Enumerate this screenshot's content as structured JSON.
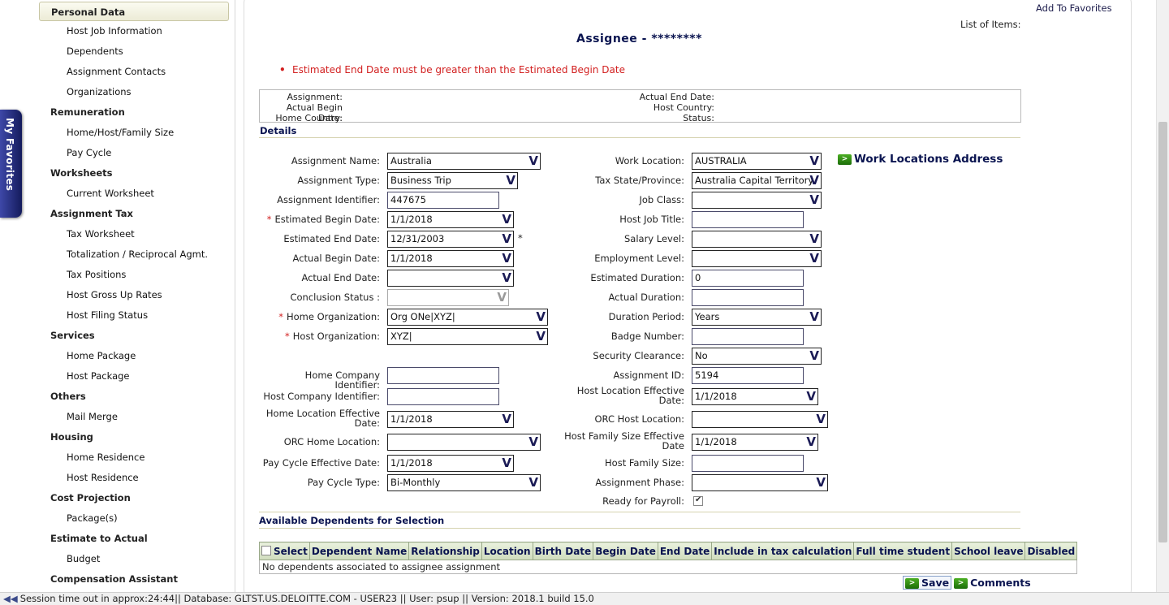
{
  "nav": {
    "sections": [
      {
        "label": "Personal Data",
        "active": true,
        "items": [
          "Host Job Information",
          "Dependents",
          "Assignment Contacts",
          "Organizations"
        ]
      },
      {
        "label": "Remuneration",
        "items": [
          "Home/Host/Family Size",
          "Pay Cycle"
        ]
      },
      {
        "label": "Worksheets",
        "items": [
          "Current Worksheet"
        ]
      },
      {
        "label": "Assignment Tax",
        "items": [
          "Tax Worksheet",
          "Totalization / Reciprocal Agmt.",
          "Tax Positions",
          "Host Gross Up Rates",
          "Host Filing Status"
        ]
      },
      {
        "label": "Services",
        "items": [
          "Home Package",
          "Host Package"
        ]
      },
      {
        "label": "Others",
        "items": [
          "Mail Merge"
        ]
      },
      {
        "label": "Housing",
        "items": [
          "Home Residence",
          "Host Residence"
        ]
      },
      {
        "label": "Cost Projection",
        "items": [
          "Package(s)"
        ]
      },
      {
        "label": "Estimate to Actual",
        "items": [
          "Budget"
        ]
      },
      {
        "label": "Compensation Assistant",
        "items": []
      }
    ],
    "my_favorites": "My Favorites"
  },
  "header": {
    "add_to_favorites": "Add To Favorites",
    "list_of_items": "List of Items:",
    "title": "Assignee - ********"
  },
  "error": {
    "bullet": "•",
    "message": "Estimated End Date must be greater than the Estimated Begin Date"
  },
  "summary": {
    "assignment": "Assignment:",
    "actual_begin_date": "Actual Begin Date:",
    "home_country": "Home Country:",
    "actual_end_date": "Actual End Date:",
    "host_country": "Host Country:",
    "status": "Status:"
  },
  "details_heading": "Details",
  "left_fields": [
    {
      "label": "Assignment Name:",
      "value": "Australia",
      "type": "select"
    },
    {
      "label": "Assignment Type:",
      "value": "Business Trip",
      "type": "select"
    },
    {
      "label": "Assignment Identifier:",
      "value": "447675",
      "type": "text"
    },
    {
      "label": "Estimated Begin Date:",
      "value": "1/1/2018",
      "type": "select",
      "required": true
    },
    {
      "label": "Estimated End Date:",
      "value": "12/31/2003",
      "type": "select"
    },
    {
      "label": "Actual Begin Date:",
      "value": "1/1/2018",
      "type": "select"
    },
    {
      "label": "Actual End Date:",
      "value": "",
      "type": "select"
    },
    {
      "label": "Conclusion Status :",
      "value": "",
      "type": "select",
      "disabled": true
    },
    {
      "label": "Home Organization:",
      "value": "Org ONe|XYZ|",
      "type": "select",
      "required": true
    },
    {
      "label": "Host Organization:",
      "value": "XYZ|",
      "type": "select",
      "required": true
    },
    {
      "label": "Home Company Identifier:",
      "value": "",
      "type": "text"
    },
    {
      "label": "Host Company Identifier:",
      "value": "",
      "type": "text"
    },
    {
      "label": "Home Location Effective Date:",
      "value": "1/1/2018",
      "type": "select"
    },
    {
      "label": "ORC Home Location:",
      "value": "",
      "type": "select"
    },
    {
      "label": "Pay Cycle Effective Date:",
      "value": "1/1/2018",
      "type": "select"
    },
    {
      "label": "Pay Cycle Type:",
      "value": "Bi-Monthly",
      "type": "select"
    }
  ],
  "required_mark": "*",
  "right_fields": [
    {
      "label": "Work Location:",
      "value": "AUSTRALIA",
      "type": "select"
    },
    {
      "label": "Tax State/Province:",
      "value": "Australia Capital Territory",
      "type": "select"
    },
    {
      "label": "Job Class:",
      "value": "",
      "type": "select"
    },
    {
      "label": "Host Job Title:",
      "value": "",
      "type": "text"
    },
    {
      "label": "Salary Level:",
      "value": "",
      "type": "select"
    },
    {
      "label": "Employment Level:",
      "value": "",
      "type": "select"
    },
    {
      "label": "Estimated Duration:",
      "value": "0",
      "type": "text"
    },
    {
      "label": "Actual Duration:",
      "value": "",
      "type": "text"
    },
    {
      "label": "Duration Period:",
      "value": "Years",
      "type": "select"
    },
    {
      "label": "Badge Number:",
      "value": "",
      "type": "text"
    },
    {
      "label": "Security Clearance:",
      "value": "No",
      "type": "select"
    },
    {
      "label": "Assignment ID:",
      "value": "5194",
      "type": "text"
    },
    {
      "label": "Host Location Effective Date:",
      "value": "1/1/2018",
      "type": "select"
    },
    {
      "label": "ORC Host Location:",
      "value": "",
      "type": "select"
    },
    {
      "label": "Host Family Size Effective Date",
      "value": "1/1/2018",
      "type": "select"
    },
    {
      "label": "Host Family Size:",
      "value": "",
      "type": "text"
    },
    {
      "label": "Assignment Phase:",
      "value": "",
      "type": "select"
    },
    {
      "label": "Ready for Payroll:",
      "value": "checked",
      "type": "checkbox"
    }
  ],
  "work_locations_address": "Work Locations Address",
  "button_arrow": ">",
  "dropdown_glyph": "V",
  "dependents": {
    "heading": "Available Dependents for Selection",
    "columns": [
      "Select",
      "Dependent Name",
      "Relationship",
      "Location",
      "Birth Date",
      "Begin Date",
      "End Date",
      "Include in tax calculation",
      "Full time student",
      "School leave",
      "Disabled"
    ],
    "empty_message": "No dependents associated to assignee assignment"
  },
  "actions": {
    "save": "Save",
    "comments": "Comments"
  },
  "status_bar": "Session time out in approx:24:44|| Database: GLTST.US.DELOITTE.COM - USER23 || User: psup || Version: 2018.1 build 15.0"
}
